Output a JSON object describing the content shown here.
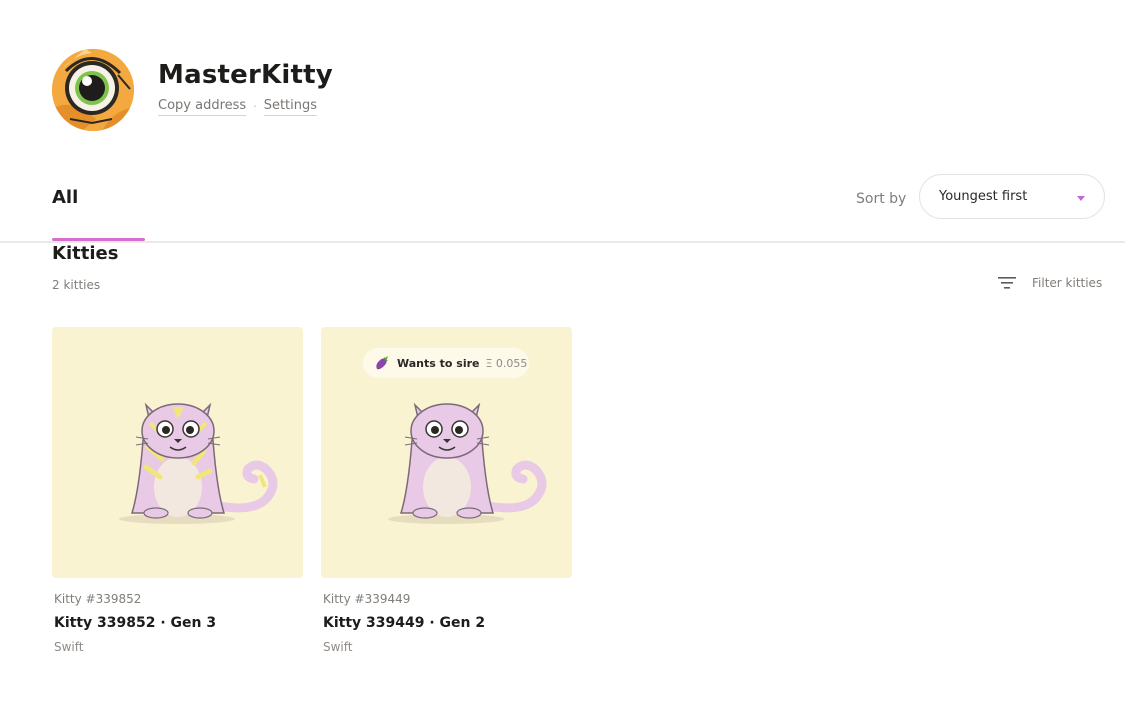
{
  "profile": {
    "username": "MasterKitty",
    "copy_address_label": "Copy address",
    "separator": "·",
    "settings_label": "Settings",
    "avatar_icon": "cat-eye-icon"
  },
  "tabs": {
    "active_label": "All Kitties",
    "accent_color": "#d56dd0"
  },
  "sort": {
    "label": "Sort by",
    "selected": "Youngest first"
  },
  "listing": {
    "count_label": "2 kitties",
    "filter_label": "Filter kitties",
    "filter_icon": "filter-icon"
  },
  "kitties": [
    {
      "id_label": "Kitty #339852",
      "name_label": "Kitty 339852 · Gen 3",
      "speed": "Swift",
      "background": "#faf3d1"
    },
    {
      "id_label": "Kitty #339449",
      "name_label": "Kitty 339449 · Gen 2",
      "speed": "Swift",
      "background": "#faf3d1",
      "badge": {
        "icon": "eggplant-icon",
        "label": "Wants to sire",
        "price": "Ξ 0.055"
      }
    }
  ]
}
